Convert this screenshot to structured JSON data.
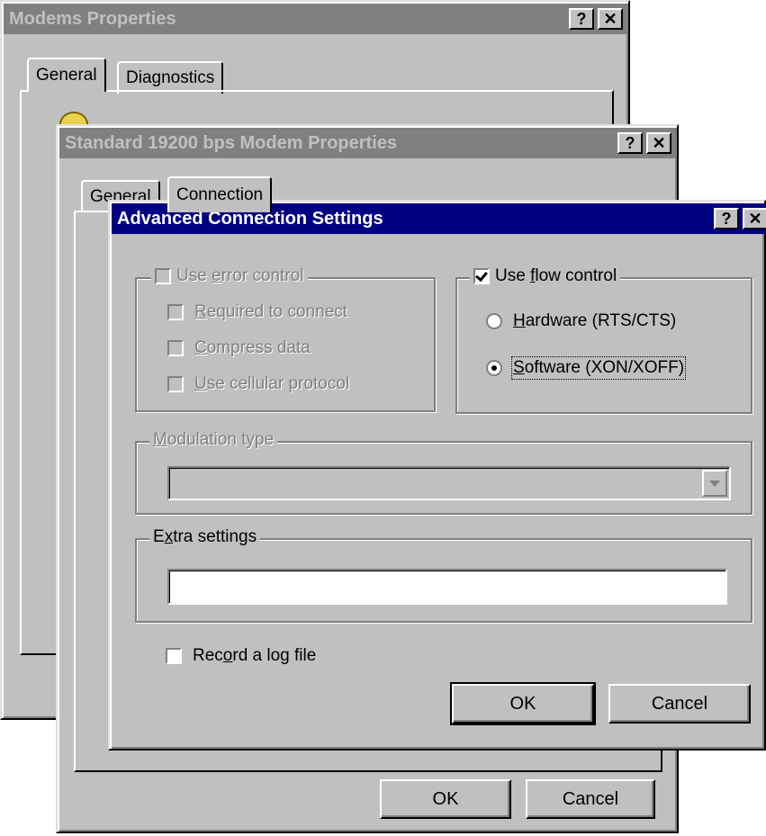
{
  "modems_window": {
    "title": "Modems Properties",
    "help_btn": "?",
    "close_btn": "✕",
    "tabs": [
      "General",
      "Diagnostics"
    ]
  },
  "modem_window": {
    "title": "Standard 19200 bps Modem Properties",
    "help_btn": "?",
    "close_btn": "✕",
    "tabs": [
      "General",
      "Connection"
    ],
    "ok_label": "OK",
    "cancel_label": "Cancel"
  },
  "advanced_dialog": {
    "title": "Advanced Connection Settings",
    "help_btn": "?",
    "close_btn": "✕",
    "error_control": {
      "label_pre": "Use ",
      "label_accel": "e",
      "label_post": "rror control",
      "checked": false,
      "enabled": false,
      "options": [
        {
          "pre": "",
          "accel": "R",
          "post": "equired to connect"
        },
        {
          "pre": "",
          "accel": "C",
          "post": "ompress data"
        },
        {
          "pre": "",
          "accel": "U",
          "post": "se cellular protocol"
        }
      ]
    },
    "flow_control": {
      "label_pre": "Use ",
      "label_accel": "f",
      "label_post": "low control",
      "checked": true,
      "hardware": {
        "pre": "",
        "accel": "H",
        "post": "ardware (RTS/CTS)",
        "selected": false
      },
      "software": {
        "pre": "",
        "accel": "S",
        "post": "oftware (XON/XOFF)",
        "selected": true
      }
    },
    "modulation": {
      "label_pre": "",
      "label_accel": "M",
      "label_post": "odulation type",
      "value": ""
    },
    "extra_settings": {
      "label_pre": "E",
      "label_accel": "x",
      "label_post": "tra settings",
      "value": ""
    },
    "log_file": {
      "label_pre": "Rec",
      "label_accel": "o",
      "label_post": "rd a log file",
      "checked": false
    },
    "ok_label": "OK",
    "cancel_label": "Cancel"
  }
}
